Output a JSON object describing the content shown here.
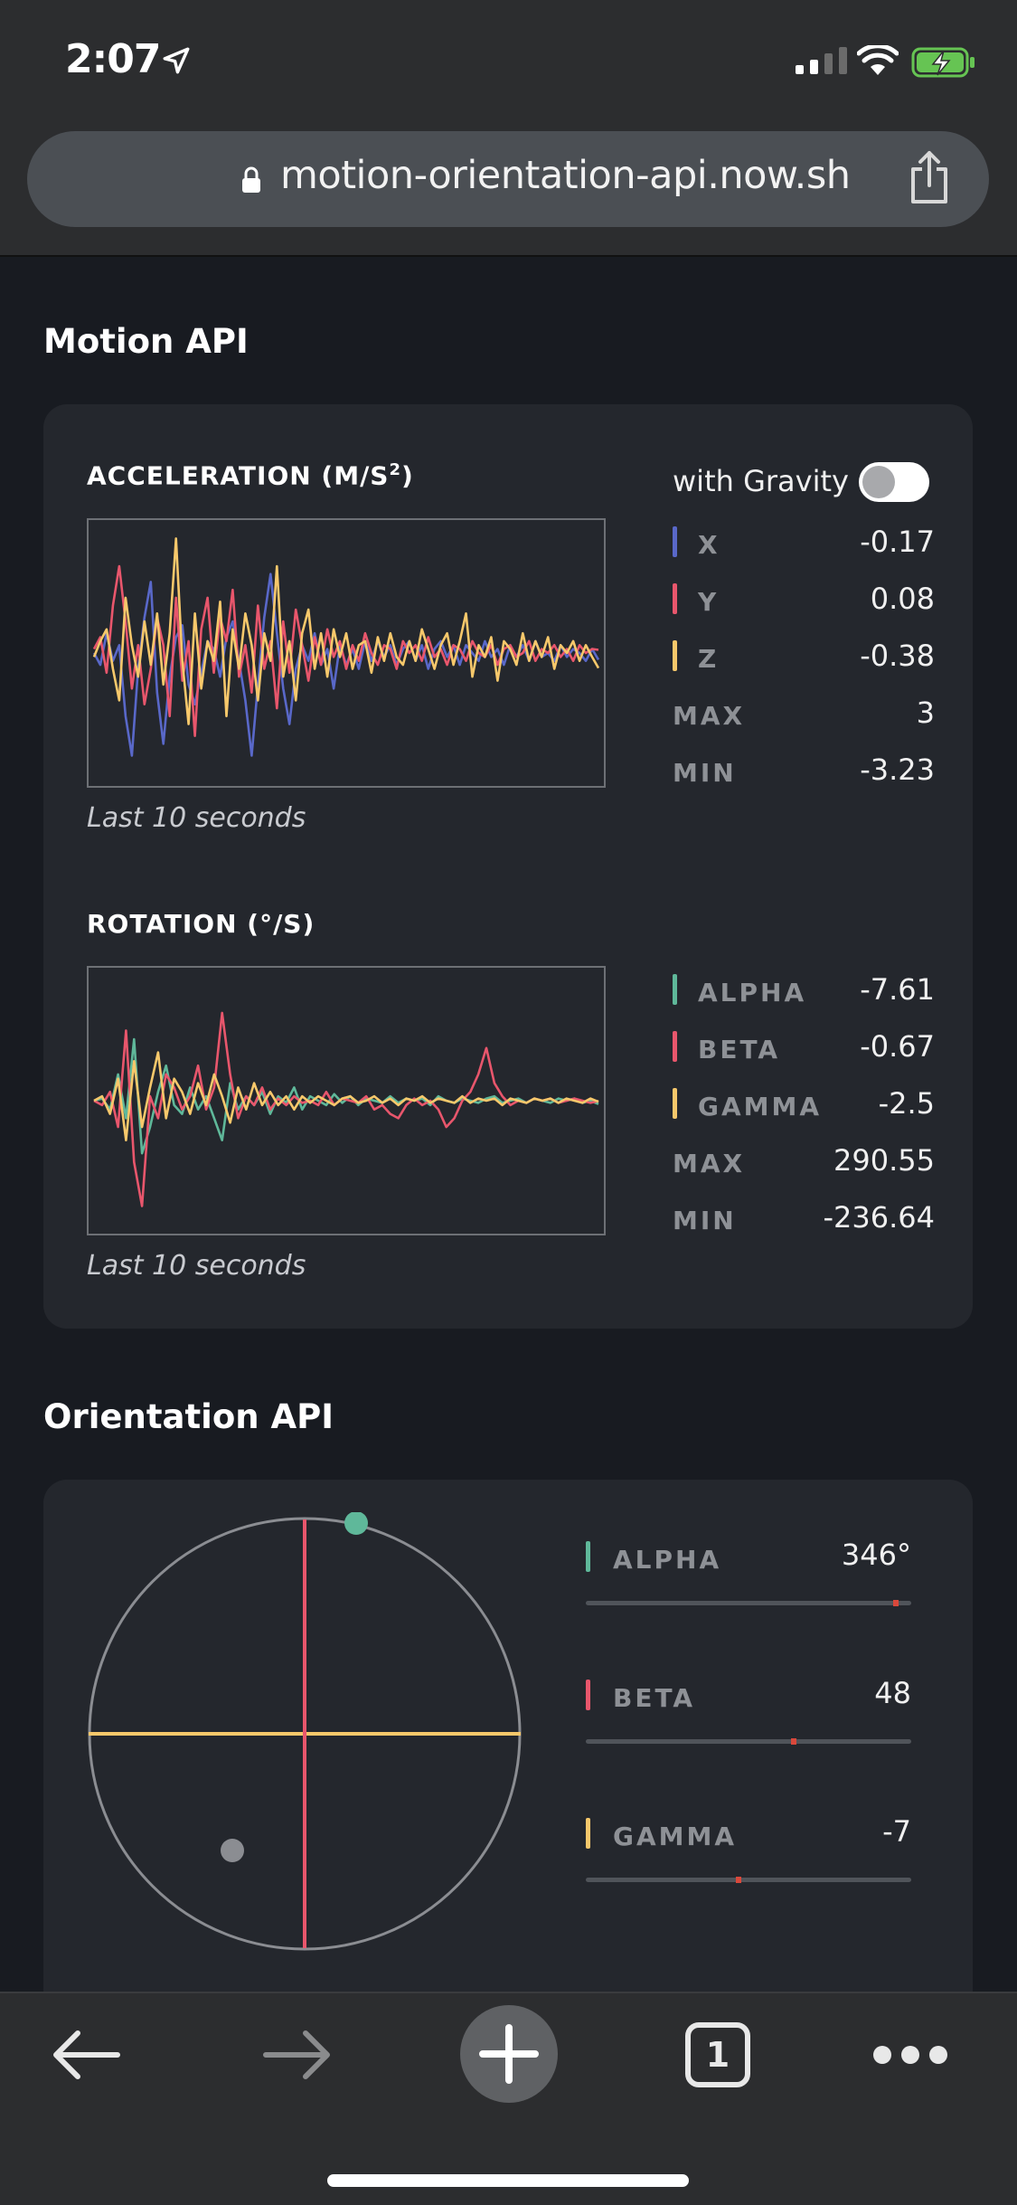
{
  "status_bar": {
    "time": "2:07"
  },
  "browser": {
    "url": "motion-orientation-api.now.sh",
    "tab_count": "1"
  },
  "motion": {
    "title": "Motion API",
    "acceleration": {
      "label": "ACCELERATION (M/S",
      "label_sup": "2",
      "label_end": ")",
      "caption": "Last 10 seconds",
      "gravity_label": "with Gravity",
      "gravity_on": false,
      "legend": [
        {
          "name": "X",
          "value": "-0.17",
          "color": "#5968c9"
        },
        {
          "name": "Y",
          "value": "0.08",
          "color": "#e8566c"
        },
        {
          "name": "Z",
          "value": "-0.38",
          "color": "#f7c86b"
        }
      ],
      "max_label": "MAX",
      "max": "3",
      "min_label": "MIN",
      "min": "-3.23"
    },
    "rotation": {
      "label": "ROTATION (°/S)",
      "caption": "Last 10 seconds",
      "legend": [
        {
          "name": "ALPHA",
          "value": "-7.61",
          "color": "#5fb89a"
        },
        {
          "name": "BETA",
          "value": "-0.67",
          "color": "#e8566c"
        },
        {
          "name": "GAMMA",
          "value": "-2.5",
          "color": "#f7c86b"
        }
      ],
      "max_label": "MAX",
      "max": "290.55",
      "min_label": "MIN",
      "min": "-236.64"
    }
  },
  "orientation": {
    "title": "Orientation API",
    "rows": [
      {
        "name": "ALPHA",
        "value": "346°",
        "color": "#5fb89a",
        "fraction": 0.96
      },
      {
        "name": "BETA",
        "value": "48",
        "color": "#e8566c",
        "fraction": 0.64
      },
      {
        "name": "GAMMA",
        "value": "-7",
        "color": "#f7c86b",
        "fraction": 0.47
      }
    ]
  },
  "chart_data": [
    {
      "type": "line",
      "title": "ACCELERATION (M/S²)",
      "ylim": [
        -3.23,
        3
      ],
      "series": [
        {
          "name": "X",
          "color": "#5968c9",
          "values": [
            0,
            -0.3,
            0.5,
            -0.2,
            0.2,
            -1.6,
            -2.6,
            -0.4,
            0.9,
            1.8,
            -1.0,
            -2.3,
            -0.6,
            0.4,
            0.7,
            -0.8,
            -1.3,
            -0.5,
            0.3,
            0.1,
            -0.6,
            0.4,
            0.8,
            -0.2,
            -1.2,
            -2.6,
            -0.8,
            0.9,
            2.0,
            0.5,
            -0.9,
            -1.8,
            -0.4,
            0.2,
            -0.2,
            0.5,
            -0.3,
            0.1,
            -0.9,
            0.2,
            -0.3,
            0.1,
            -0.4,
            0.3,
            -0.2,
            0.3,
            -0.1,
            0.2,
            -0.3,
            0.1,
            0.3,
            -0.2,
            0.2,
            -0.4,
            0.1,
            0.3,
            -0.1,
            0.2,
            -0.3,
            0.2,
            0.0,
            -0.2,
            0.3,
            -0.1,
            0.1,
            -0.3,
            0.2,
            -0.1,
            0.2,
            -0.2,
            0.3,
            -0.1,
            0.0,
            -0.2,
            0.2,
            -0.1,
            0.1,
            0.0,
            -0.2,
            0.1,
            -0.17
          ]
        },
        {
          "name": "Y",
          "color": "#e8566c",
          "values": [
            0.1,
            0.4,
            -0.5,
            1.2,
            2.2,
            0.8,
            -0.9,
            0.2,
            -1.3,
            -0.4,
            0.9,
            0.2,
            -1.6,
            1.4,
            -0.7,
            0.3,
            -2.1,
            0.6,
            1.4,
            -0.5,
            0.9,
            0.3,
            1.6,
            -0.6,
            0.2,
            -1.0,
            1.2,
            -0.4,
            0.3,
            -1.4,
            0.8,
            -0.5,
            1.1,
            0.2,
            -0.7,
            0.4,
            -0.3,
            0.6,
            -0.1,
            0.3,
            -0.4,
            0.2,
            -0.2,
            0.5,
            0.0,
            -0.3,
            0.2,
            0.1,
            -0.4,
            0.3,
            0.0,
            0.2,
            -0.2,
            0.4,
            -0.1,
            0.1,
            -0.3,
            0.2,
            0.1,
            -0.2,
            0.3,
            0.0,
            -0.1,
            0.2,
            -0.3,
            0.1,
            0.2,
            -0.1,
            0.0,
            0.3,
            -0.2,
            0.1,
            0.0,
            0.2,
            -0.1,
            0.1,
            -0.2,
            0.2,
            0.0,
            0.1,
            0.08
          ]
        },
        {
          "name": "Z",
          "color": "#f7c86b",
          "values": [
            -0.1,
            0.3,
            0.6,
            -0.4,
            -1.2,
            1.4,
            0.2,
            -0.6,
            0.8,
            -0.3,
            1.0,
            -0.8,
            0.5,
            2.9,
            -0.2,
            -1.8,
            1.0,
            -0.9,
            0.3,
            -0.2,
            1.3,
            -1.6,
            0.6,
            -0.4,
            1.0,
            0.2,
            -1.2,
            0.5,
            -0.2,
            2.2,
            -0.6,
            0.3,
            -1.2,
            0.5,
            1.1,
            -0.4,
            0.5,
            -0.6,
            0.6,
            -0.1,
            0.5,
            -0.4,
            0.2,
            0.3,
            -0.5,
            0.4,
            -0.2,
            0.5,
            -0.1,
            -0.3,
            0.3,
            -0.2,
            0.6,
            0.1,
            -0.4,
            0.2,
            0.5,
            -0.3,
            0.3,
            1.0,
            -0.6,
            0.2,
            -0.1,
            0.4,
            -0.7,
            0.3,
            0.1,
            -0.3,
            0.5,
            -0.2,
            0.3,
            -0.1,
            0.4,
            -0.4,
            0.2,
            0.0,
            0.3,
            -0.2,
            0.2,
            -0.1,
            -0.38
          ]
        }
      ]
    },
    {
      "type": "line",
      "title": "ROTATION (°/S)",
      "ylim": [
        -236.64,
        290.55
      ],
      "series": [
        {
          "name": "ALPHA",
          "color": "#5fb89a",
          "values": [
            0,
            5,
            -20,
            60,
            -40,
            140,
            -120,
            -60,
            20,
            80,
            -10,
            -30,
            30,
            -20,
            10,
            -40,
            -90,
            40,
            -20,
            10,
            -10,
            20,
            -30,
            10,
            -5,
            30,
            -20,
            10,
            0,
            -10,
            15,
            -5,
            10,
            -10,
            5,
            0,
            -5,
            10,
            -5,
            5,
            0,
            5,
            -10,
            10,
            0,
            -5,
            5,
            0,
            -5,
            5,
            10,
            -5,
            0,
            5,
            -5,
            5,
            0,
            -5,
            5,
            0,
            5,
            -5,
            0,
            -7.61
          ]
        },
        {
          "name": "BETA",
          "color": "#e8566c",
          "values": [
            0,
            -10,
            20,
            -60,
            160,
            -140,
            -240,
            10,
            -40,
            60,
            30,
            -20,
            10,
            80,
            -20,
            30,
            200,
            60,
            -40,
            10,
            -10,
            30,
            -20,
            5,
            -10,
            10,
            -5,
            0,
            -10,
            20,
            -10,
            5,
            0,
            -5,
            10,
            -20,
            -10,
            -30,
            -40,
            -10,
            5,
            -10,
            0,
            -20,
            -60,
            -40,
            0,
            20,
            60,
            120,
            40,
            10,
            -10,
            0,
            -5,
            5,
            0,
            5,
            -5,
            0,
            5,
            0,
            -5,
            -0.67
          ]
        },
        {
          "name": "GAMMA",
          "color": "#f7c86b",
          "values": [
            0,
            10,
            -30,
            50,
            -90,
            90,
            -60,
            30,
            110,
            -40,
            50,
            20,
            -30,
            40,
            -10,
            60,
            10,
            -50,
            30,
            -20,
            40,
            -10,
            20,
            -10,
            10,
            -20,
            10,
            -5,
            10,
            0,
            -10,
            5,
            10,
            -5,
            0,
            10,
            -5,
            5,
            -10,
            5,
            0,
            10,
            -5,
            5,
            0,
            -5,
            10,
            -5,
            5,
            0,
            5,
            -10,
            5,
            0,
            -5,
            5,
            0,
            5,
            -5,
            5,
            0,
            -5,
            5,
            -2.5
          ]
        }
      ]
    }
  ]
}
